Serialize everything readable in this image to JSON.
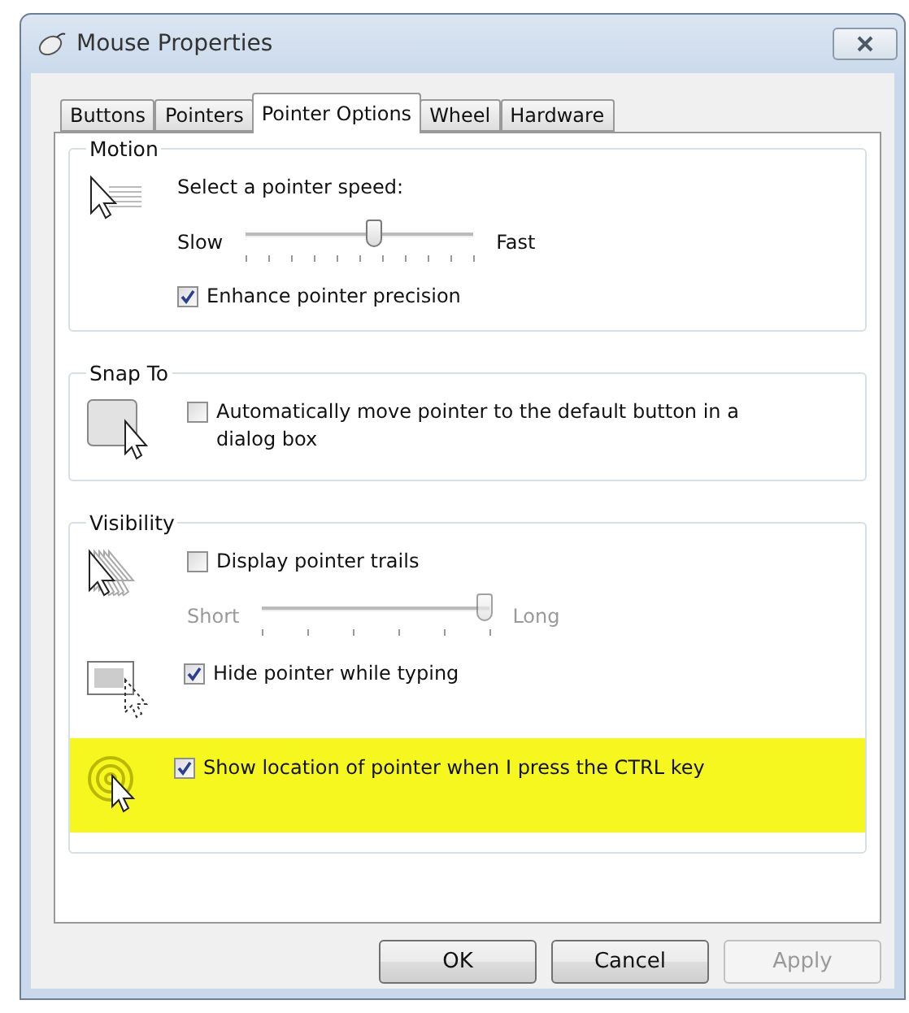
{
  "window": {
    "title": "Mouse Properties"
  },
  "tabs": [
    {
      "label": "Buttons",
      "selected": false
    },
    {
      "label": "Pointers",
      "selected": false
    },
    {
      "label": "Pointer Options",
      "selected": true
    },
    {
      "label": "Wheel",
      "selected": false
    },
    {
      "label": "Hardware",
      "selected": false
    }
  ],
  "groups": [
    {
      "title": "Motion",
      "sections": [
        {
          "highlighted": false,
          "rows": [
            {
              "kind": "caption",
              "text": "Select a pointer speed:"
            },
            {
              "kind": "slider",
              "min_label": "Slow",
              "max_label": "Fast",
              "level": 0.56,
              "disabled": false
            },
            {
              "kind": "checkbox",
              "label": "Enhance pointer precision",
              "checked": true
            }
          ]
        }
      ]
    },
    {
      "title": "Snap To",
      "sections": [
        {
          "highlighted": false,
          "rows": [
            {
              "kind": "checkbox",
              "label": "Automatically move pointer to the default button in a dialog box",
              "checked": false
            }
          ]
        }
      ]
    },
    {
      "title": "Visibility",
      "sections": [
        {
          "highlighted": false,
          "rows": [
            {
              "kind": "checkbox",
              "label": "Display pointer trails",
              "checked": false
            },
            {
              "kind": "slider",
              "min_label": "Short",
              "max_label": "Long",
              "level": 0.98,
              "disabled": true
            }
          ]
        },
        {
          "highlighted": false,
          "rows": [
            {
              "kind": "checkbox",
              "label": "Hide pointer while typing",
              "checked": true
            }
          ]
        },
        {
          "highlighted": true,
          "rows": [
            {
              "kind": "checkbox",
              "label": "Show location of pointer when I press the CTRL key",
              "checked": true
            }
          ]
        }
      ]
    }
  ],
  "buttons": [
    {
      "label": "OK",
      "disabled": false
    },
    {
      "label": "Cancel",
      "disabled": false
    },
    {
      "label": "Apply",
      "disabled": true
    }
  ]
}
